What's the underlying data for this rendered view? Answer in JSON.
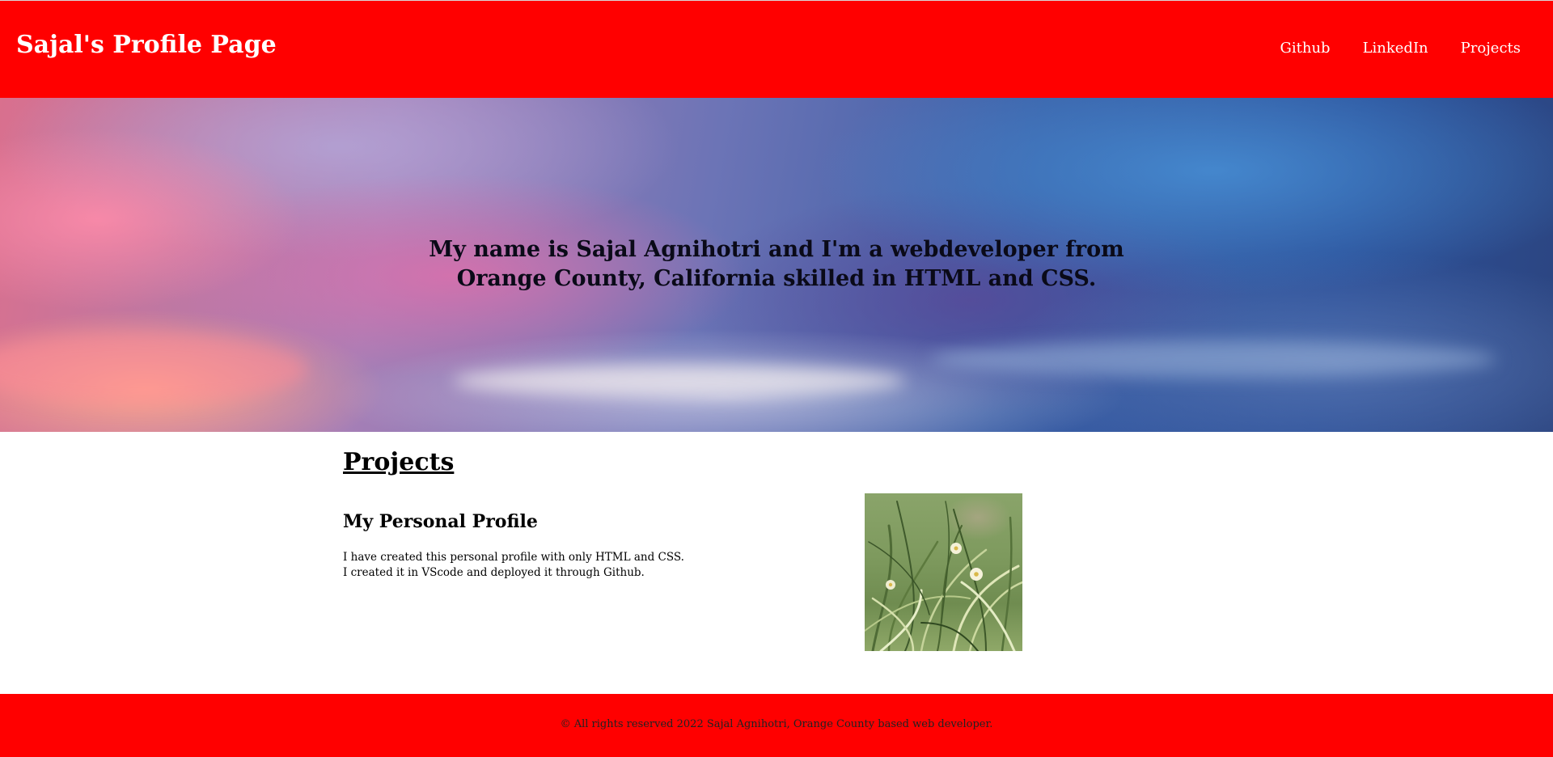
{
  "header": {
    "title": "Sajal's Profile Page",
    "nav": [
      {
        "label": "Github"
      },
      {
        "label": "LinkedIn"
      },
      {
        "label": "Projects"
      }
    ]
  },
  "hero": {
    "text": "My name is Sajal Agnihotri and I'm a webdeveloper from Orange County, California skilled in HTML and CSS."
  },
  "projects": {
    "heading": "Projects",
    "items": [
      {
        "title": "My Personal Profile",
        "description_lines": [
          "I have created this personal profile with only HTML and CSS.",
          "I created it in VScode and deployed it through Github."
        ]
      }
    ]
  },
  "footer": {
    "text": "© All rights reserved 2022 Sajal Agnihotri, Orange County based web developer."
  },
  "colors": {
    "header_bg": "#ff0000",
    "footer_bg": "#ff0000",
    "page_bg": "#ffffff"
  }
}
